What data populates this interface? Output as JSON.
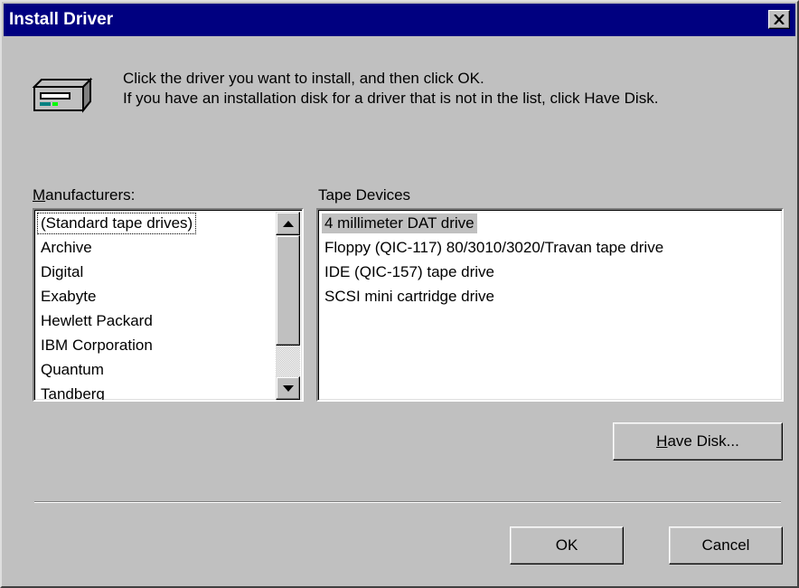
{
  "window": {
    "title": "Install Driver",
    "close_glyph": "✕"
  },
  "intro": {
    "line1": "Click the driver you want to install, and then click OK.",
    "line2": "If you have an installation disk for a driver that is not in the list, click Have Disk."
  },
  "manufacturers": {
    "label_accel": "M",
    "label_rest": "anufacturers:",
    "selected_index": 0,
    "items": [
      "(Standard tape drives)",
      "Archive",
      "Digital",
      "Exabyte",
      "Hewlett Packard",
      "IBM Corporation",
      "Quantum",
      "Tandberg"
    ]
  },
  "devices": {
    "label": "Tape Devices",
    "selected_index": 0,
    "items": [
      "4 millimeter DAT drive",
      "Floppy (QIC-117) 80/3010/3020/Travan tape drive",
      "IDE (QIC-157) tape drive",
      "SCSI mini cartridge drive"
    ]
  },
  "buttons": {
    "have_disk_accel": "H",
    "have_disk_rest": "ave Disk...",
    "ok": "OK",
    "cancel": "Cancel"
  },
  "icons": {
    "dialog": "tape-drive-icon",
    "close": "close-icon",
    "scroll_up": "scroll-up-arrow-icon",
    "scroll_down": "scroll-down-arrow-icon"
  },
  "colors": {
    "titlebar": "#000080",
    "face": "#c0c0c0"
  }
}
